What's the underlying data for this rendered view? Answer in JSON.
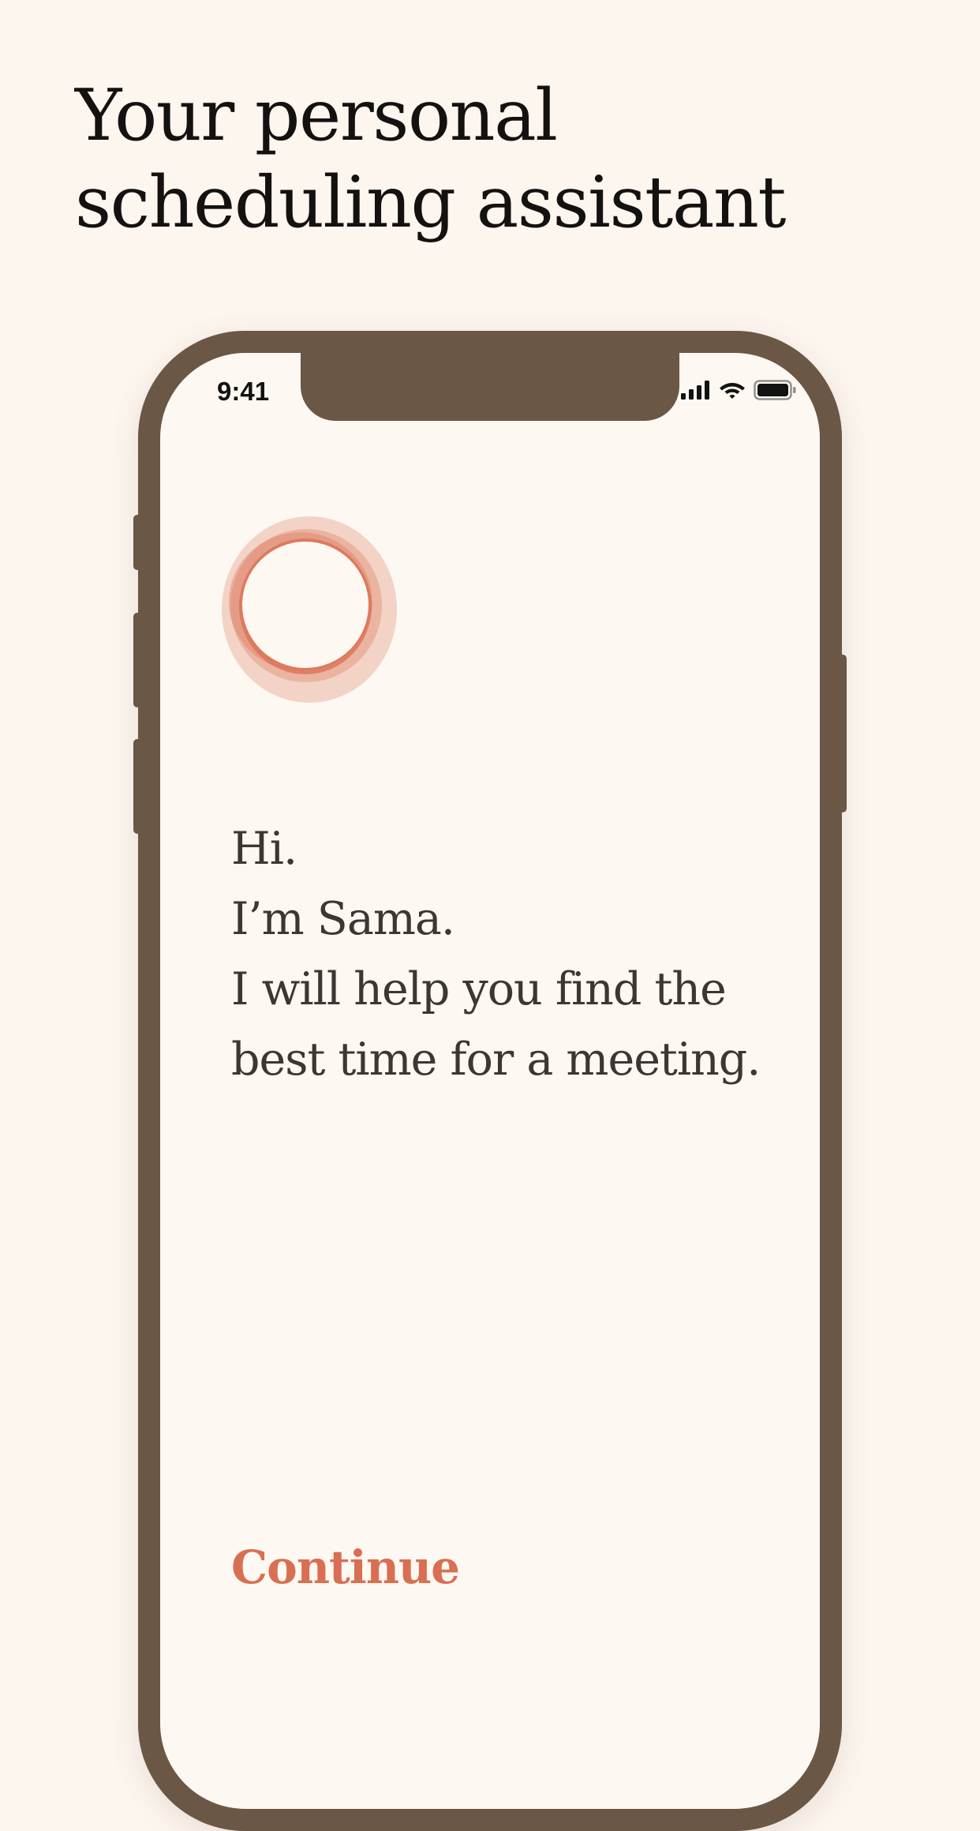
{
  "headline": {
    "line1": "Your personal",
    "line2": "scheduling assistant"
  },
  "status_bar": {
    "time": "9:41",
    "icons": [
      "cellular-signal-icon",
      "wifi-icon",
      "battery-icon"
    ]
  },
  "logo": {
    "icon": "sama-ring-logo-icon",
    "colors": {
      "ring": "#d96f52",
      "halo": "#eab4a3"
    }
  },
  "greeting": {
    "lines": [
      "Hi.",
      "I’m Sama.",
      "I will help you find the",
      "best time for a meeting."
    ]
  },
  "continue_label": "Continue",
  "colors": {
    "background": "#fdf6ef",
    "phone_frame": "#6b5745",
    "screen": "#fef8f2",
    "accent": "#d96f52",
    "body_text": "#3b3733"
  }
}
